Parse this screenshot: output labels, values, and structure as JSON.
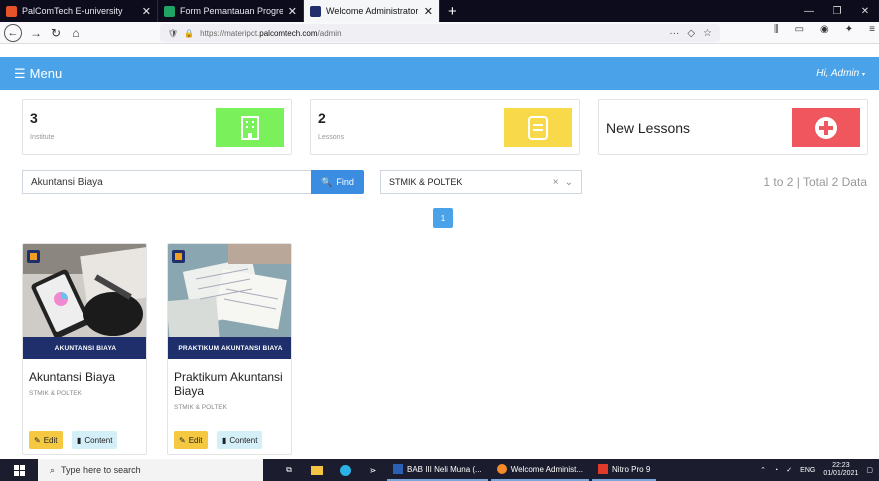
{
  "browser": {
    "tabs": [
      {
        "title": "PalComTech E-university",
        "active": false,
        "color": "#e5532a"
      },
      {
        "title": "Form Pemantauan Progress Pe",
        "active": false,
        "color": "#1fa463"
      },
      {
        "title": "Welcome Administrator",
        "active": true,
        "color": "#1e2f6b"
      }
    ],
    "url_prefix": "https://materipct.",
    "url_domain": "palcomtech.com",
    "url_path": "/admin",
    "url_more": "···"
  },
  "header": {
    "menu_label": "Menu",
    "greeting": "Hi, Admin"
  },
  "stats": {
    "institute": {
      "count": "3",
      "label": "Institute",
      "color": "#7af05a"
    },
    "lessons": {
      "count": "2",
      "label": "Lessons",
      "color": "#f7d94a"
    },
    "new_lessons": {
      "label": "New Lessons",
      "color": "#f0565e"
    }
  },
  "search": {
    "value": "Akuntansi Biaya",
    "find_label": "Find",
    "filter_value": "STMIK & POLTEK",
    "result_info": "1 to 2 | Total 2 Data"
  },
  "pagination": {
    "current": "1"
  },
  "lessons": [
    {
      "banner": "AKUNTANSI BIAYA",
      "title": "Akuntansi Biaya",
      "subtitle": "STMIK & POLTEK",
      "edit_label": "Edit",
      "content_label": "Content"
    },
    {
      "banner": "PRAKTIKUM AKUNTANSI BIAYA",
      "title": "Praktikum Akuntansi Biaya",
      "subtitle": "STMIK & POLTEK",
      "edit_label": "Edit",
      "content_label": "Content"
    }
  ],
  "taskbar": {
    "search_placeholder": "Type here to search",
    "apps": [
      {
        "label": "BAB III Neli Muna (..."
      },
      {
        "label": "Welcome Administ..."
      },
      {
        "label": "Nitro Pro 9"
      }
    ],
    "lang": "ENG",
    "time": "22:23",
    "date": "01/01/2021"
  }
}
